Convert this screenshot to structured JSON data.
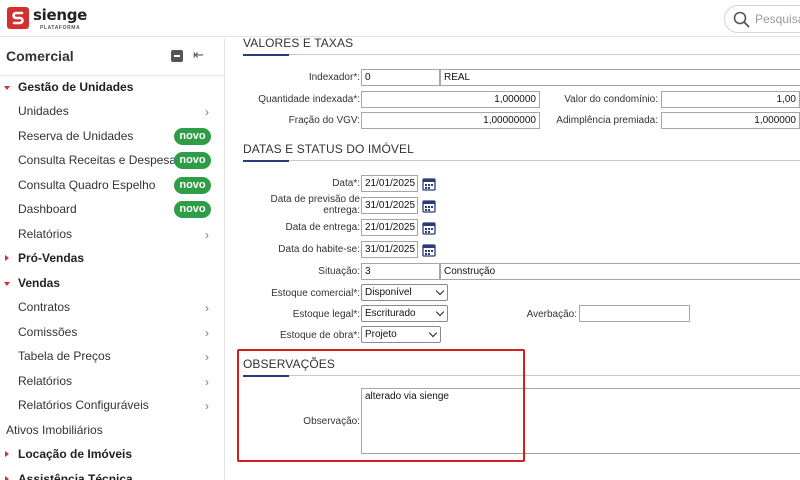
{
  "header": {
    "brand": "sienge",
    "brand_sub": "PLATAFORMA",
    "search_placeholder": "Pesquisar"
  },
  "sidebar": {
    "title": "Comercial",
    "items": [
      {
        "label": "Gestão de Unidades",
        "kind": "group",
        "expanded": true
      },
      {
        "label": "Unidades",
        "kind": "sub",
        "chevron": true
      },
      {
        "label": "Reserva de Unidades",
        "kind": "sub",
        "badge": "novo"
      },
      {
        "label": "Consulta Receitas e Despesas",
        "kind": "sub",
        "badge": "novo"
      },
      {
        "label": "Consulta Quadro Espelho",
        "kind": "sub",
        "badge": "novo"
      },
      {
        "label": "Dashboard",
        "kind": "sub",
        "badge": "novo"
      },
      {
        "label": "Relatórios",
        "kind": "sub",
        "chevron": true
      },
      {
        "label": "Pró-Vendas",
        "kind": "group",
        "expanded": false
      },
      {
        "label": "Vendas",
        "kind": "group",
        "expanded": true
      },
      {
        "label": "Contratos",
        "kind": "sub",
        "chevron": true
      },
      {
        "label": "Comissões",
        "kind": "sub",
        "chevron": true
      },
      {
        "label": "Tabela de Preços",
        "kind": "sub",
        "chevron": true
      },
      {
        "label": "Relatórios",
        "kind": "sub",
        "chevron": true
      },
      {
        "label": "Relatórios Configuráveis",
        "kind": "sub",
        "chevron": true
      },
      {
        "label": "Ativos Imobiliários",
        "kind": "plain"
      },
      {
        "label": "Locação de Imóveis",
        "kind": "group",
        "expanded": false
      },
      {
        "label": "Assistência Técnica",
        "kind": "group",
        "expanded": false
      }
    ]
  },
  "valores": {
    "title": "VALORES E TAXAS",
    "indexador_label": "Indexador*:",
    "indexador_code": "0",
    "indexador_name": "REAL",
    "quantidade_label": "Quantidade indexada*:",
    "quantidade_value": "1,000000",
    "condominio_label": "Valor do condomínio:",
    "condominio_value": "1,00",
    "fracao_label": "Fração do VGV:",
    "fracao_value": "1,00000000",
    "adimplencia_label": "Adimplência premiada:",
    "adimplencia_value": "1,000000"
  },
  "datas": {
    "title": "DATAS E STATUS DO IMÓVEL",
    "data_label": "Data*:",
    "data_value": "21/01/2025",
    "previsao_label_1": "Data de previsão de",
    "previsao_label_2": "entrega:",
    "previsao_value": "31/01/2025",
    "entrega_label": "Data de entrega:",
    "entrega_value": "21/01/2025",
    "habitese_label": "Data do habite-se:",
    "habitese_value": "31/01/2025",
    "situacao_label": "Situação:",
    "situacao_code": "3",
    "situacao_name": "Construção",
    "estoque_comercial_label": "Estoque comercial*:",
    "estoque_comercial_value": "Disponível",
    "estoque_legal_label": "Estoque legal*:",
    "estoque_legal_value": "Escriturado",
    "averbacao_label": "Averbação:",
    "averbacao_value": "",
    "estoque_obra_label": "Estoque de obra*:",
    "estoque_obra_value": "Projeto"
  },
  "observacoes": {
    "title": "OBSERVAÇÕES",
    "label": "Observação:",
    "value": "alterado via sienge"
  },
  "colors": {
    "accent": "#2b3a7a",
    "brand_red": "#d32f2f",
    "badge_green": "#2e9e46",
    "highlight": "#d71c1c"
  }
}
